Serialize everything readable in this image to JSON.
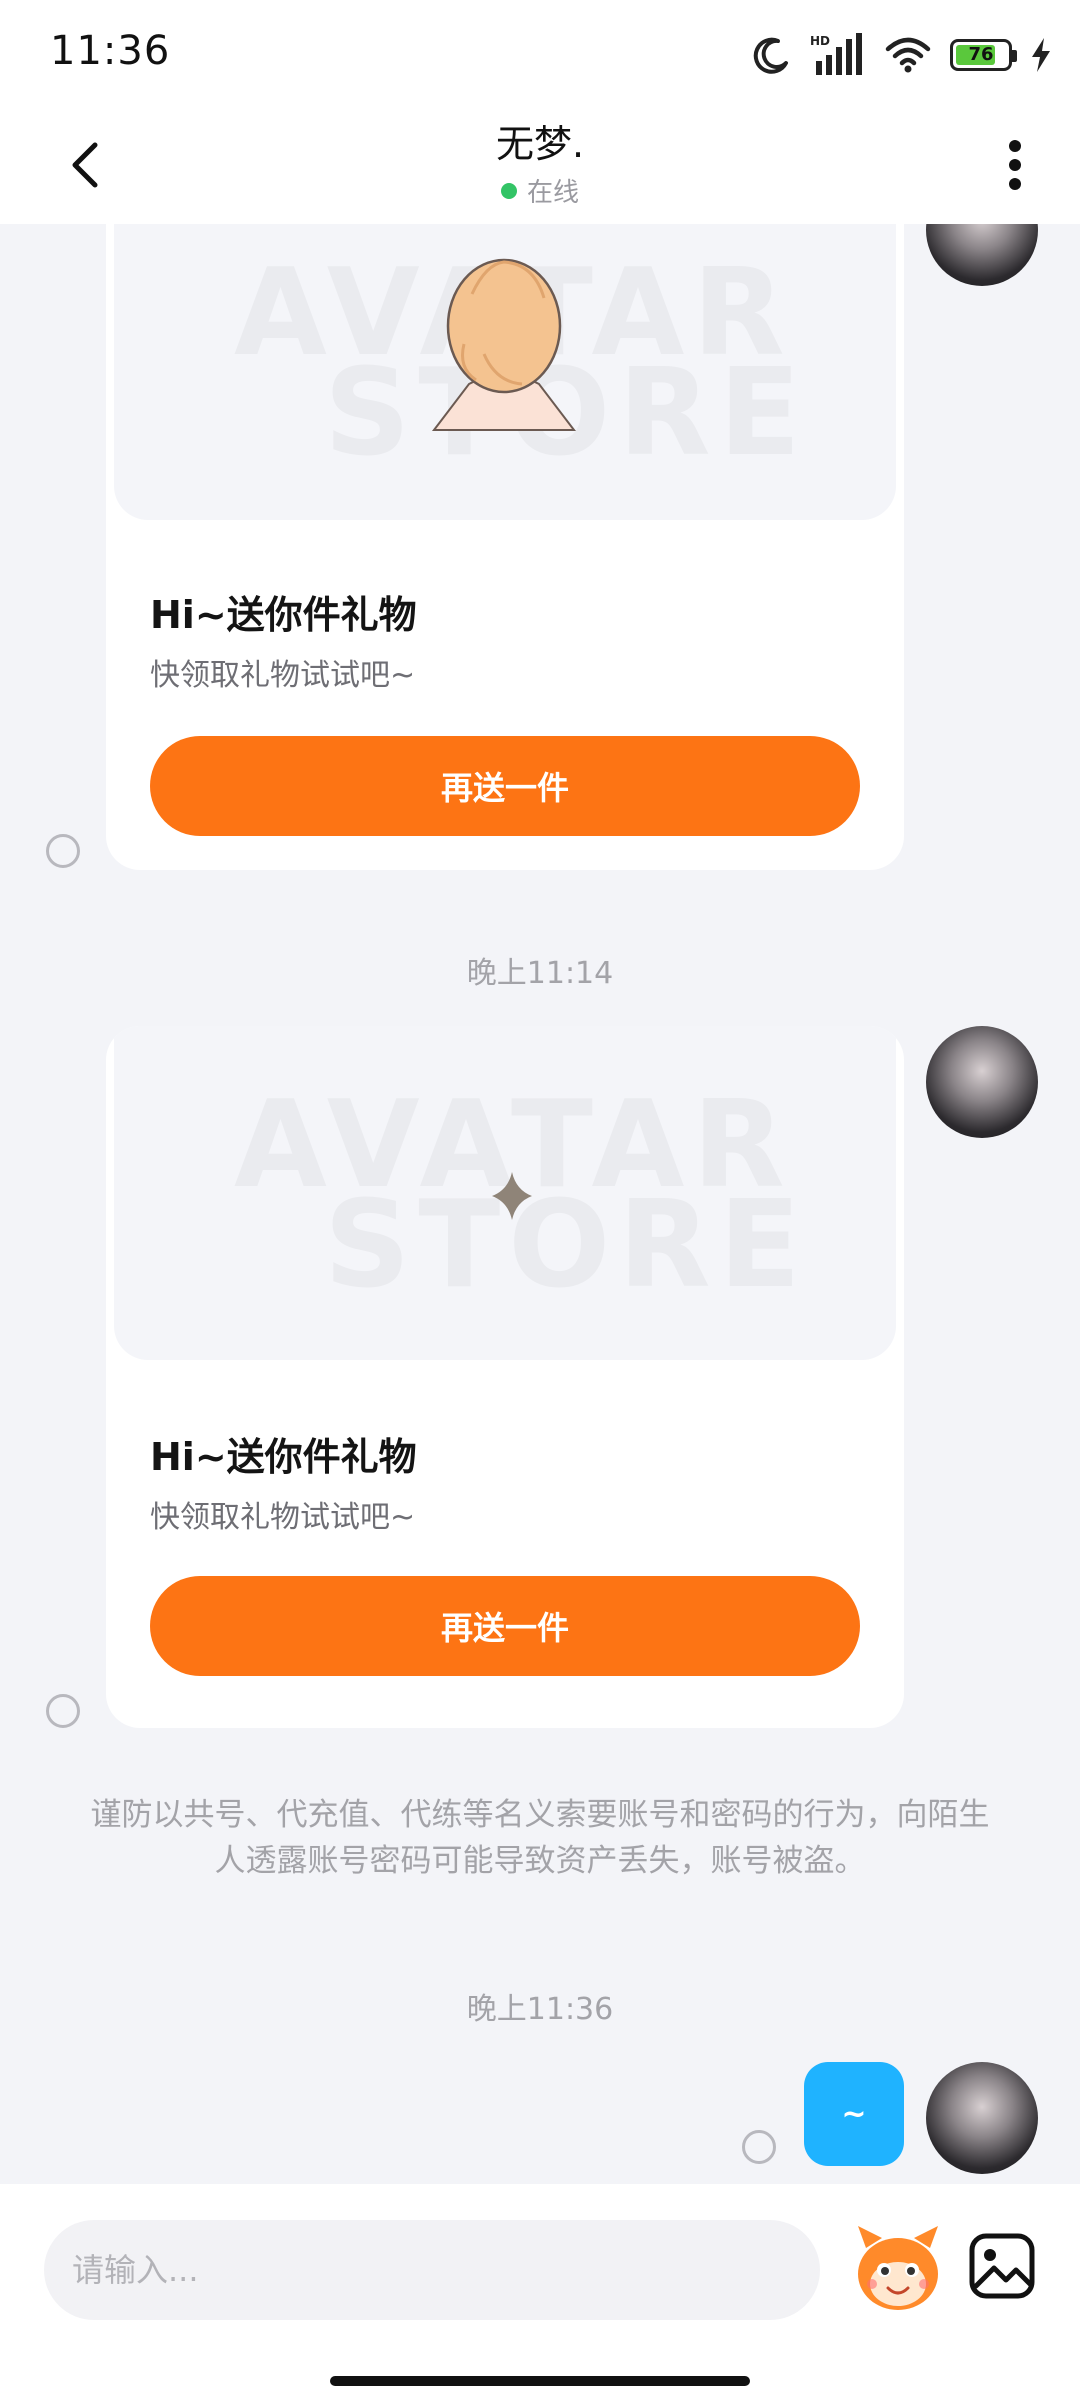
{
  "status_bar": {
    "time": "11:36",
    "battery": "76"
  },
  "header": {
    "title": "无梦.",
    "status": "在线"
  },
  "messages": [
    {
      "card_title": "Hi~送你件礼物",
      "card_desc": "快领取礼物试试吧~",
      "button_label": "再送一件"
    },
    {
      "card_title": "Hi~送你件礼物",
      "card_desc": "快领取礼物试试吧~",
      "button_label": "再送一件"
    }
  ],
  "timestamps": [
    "晚上11:14",
    "晚上11:36"
  ],
  "watermark": [
    "AVATAR",
    "STORE"
  ],
  "security_notice": "谨防以共号、代充值、代练等名义索要账号和密码的行为，向陌生人透露账号密码可能导致资产丢失，账号被盗。",
  "sent_message": "~",
  "input": {
    "placeholder": "请输入..."
  },
  "colors": {
    "accent_orange": "#fd7414",
    "bubble_blue": "#1fb3ff",
    "online_green": "#33c466"
  }
}
